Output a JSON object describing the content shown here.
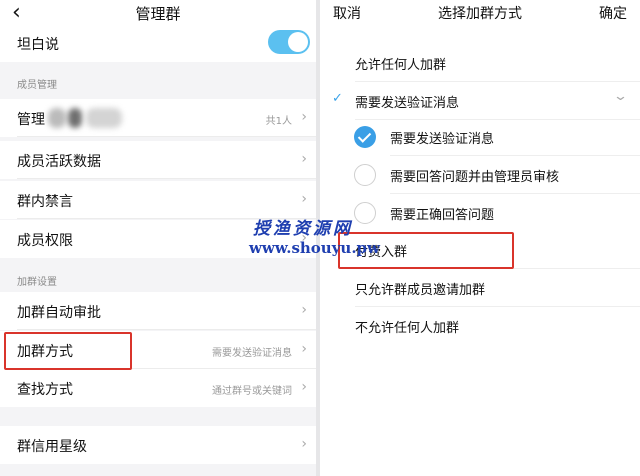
{
  "left": {
    "back_icon": "chevron-left-icon",
    "title": "管理群",
    "rows": {
      "tanbai": {
        "label": "坦白说",
        "toggle_on": true
      },
      "section_members": "成员管理",
      "manage_group": {
        "label": "管理",
        "value": "共1人"
      },
      "member_activity": {
        "label": "成员活跃数据"
      },
      "mute": {
        "label": "群内禁言"
      },
      "permissions": {
        "label": "成员权限"
      },
      "section_join": "加群设置",
      "auto_approve": {
        "label": "加群自动审批"
      },
      "join_method": {
        "label": "加群方式",
        "value": "需要发送验证消息"
      },
      "find_method": {
        "label": "查找方式",
        "value": "通过群号或关键词"
      },
      "credit_level": {
        "label": "群信用星级"
      }
    }
  },
  "right": {
    "cancel": "取消",
    "title": "选择加群方式",
    "confirm": "确定",
    "options": {
      "allow_anyone": "允许任何人加群",
      "need_verify": "需要发送验证消息",
      "sub_verify": "需要发送验证消息",
      "sub_question_admin": "需要回答问题并由管理员审核",
      "sub_correct_answer": "需要正确回答问题",
      "pay_to_join": "付费入群",
      "members_invite_only": "只允许群成员邀请加群",
      "deny_all": "不允许任何人加群"
    }
  },
  "watermark": {
    "line1": "授渔资源网",
    "line2": "www.shouyu.pw"
  },
  "colors": {
    "accent": "#3a9fe6",
    "toggle": "#5bc0f0",
    "highlight_box": "#d9342b",
    "watermark": "#1f3fb0"
  }
}
